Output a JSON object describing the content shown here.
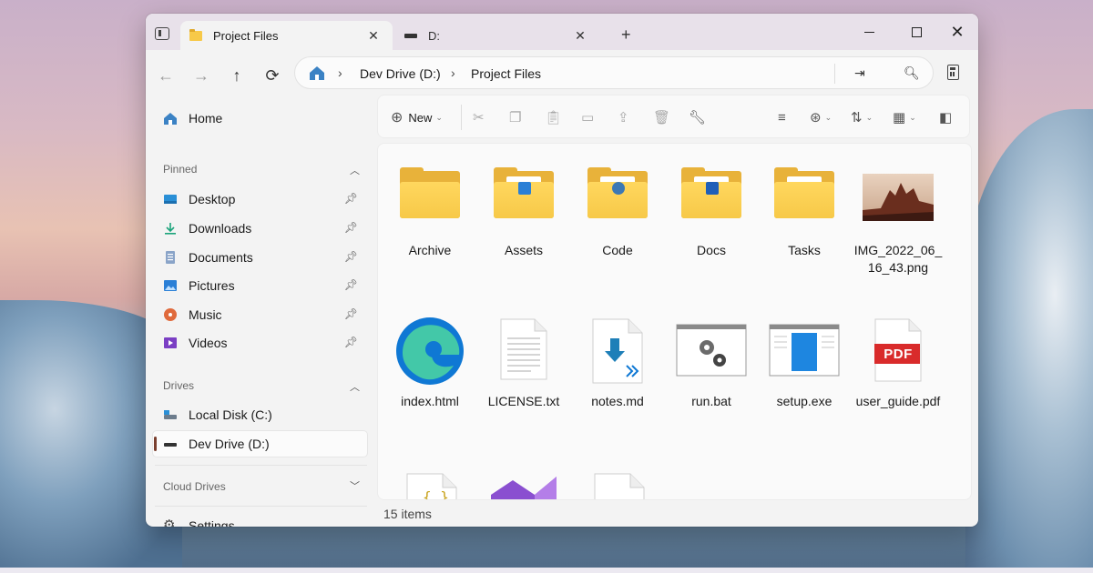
{
  "window": {
    "tabs": [
      {
        "label": "Project Files",
        "active": true
      },
      {
        "label": "D:",
        "active": false
      }
    ]
  },
  "address": {
    "crumbs": [
      "Dev Drive (D:)",
      "Project Files"
    ]
  },
  "sidebar": {
    "home": "Home",
    "pinned_header": "Pinned",
    "pinned": [
      {
        "label": "Desktop",
        "icon": "desktop-icon"
      },
      {
        "label": "Downloads",
        "icon": "downloads-icon"
      },
      {
        "label": "Documents",
        "icon": "documents-icon"
      },
      {
        "label": "Pictures",
        "icon": "pictures-icon"
      },
      {
        "label": "Music",
        "icon": "music-icon"
      },
      {
        "label": "Videos",
        "icon": "videos-icon"
      }
    ],
    "drives_header": "Drives",
    "drives": [
      {
        "label": "Local Disk (C:)"
      },
      {
        "label": "Dev Drive (D:)",
        "selected": true
      }
    ],
    "cloud_header": "Cloud Drives",
    "settings": "Settings"
  },
  "toolbar": {
    "new_label": "New"
  },
  "files": [
    {
      "name": "Archive",
      "type": "folder"
    },
    {
      "name": "Assets",
      "type": "folder"
    },
    {
      "name": "Code",
      "type": "folder"
    },
    {
      "name": "Docs",
      "type": "folder"
    },
    {
      "name": "Tasks",
      "type": "folder"
    },
    {
      "name": "IMG_2022_06_16_43.png",
      "type": "image"
    },
    {
      "name": "index.html",
      "type": "edge-file"
    },
    {
      "name": "LICENSE.txt",
      "type": "text-file"
    },
    {
      "name": "notes.md",
      "type": "markdown-file"
    },
    {
      "name": "run.bat",
      "type": "batch-file"
    },
    {
      "name": "setup.exe",
      "type": "exe-file"
    },
    {
      "name": "user_guide.pdf",
      "type": "pdf-file"
    }
  ],
  "pdf_badge": "PDF",
  "status": {
    "items_count": "15 items"
  },
  "colors": {
    "accent": "#7a3f2f",
    "folder": "#f7c948",
    "pdf_red": "#d92b2b"
  }
}
